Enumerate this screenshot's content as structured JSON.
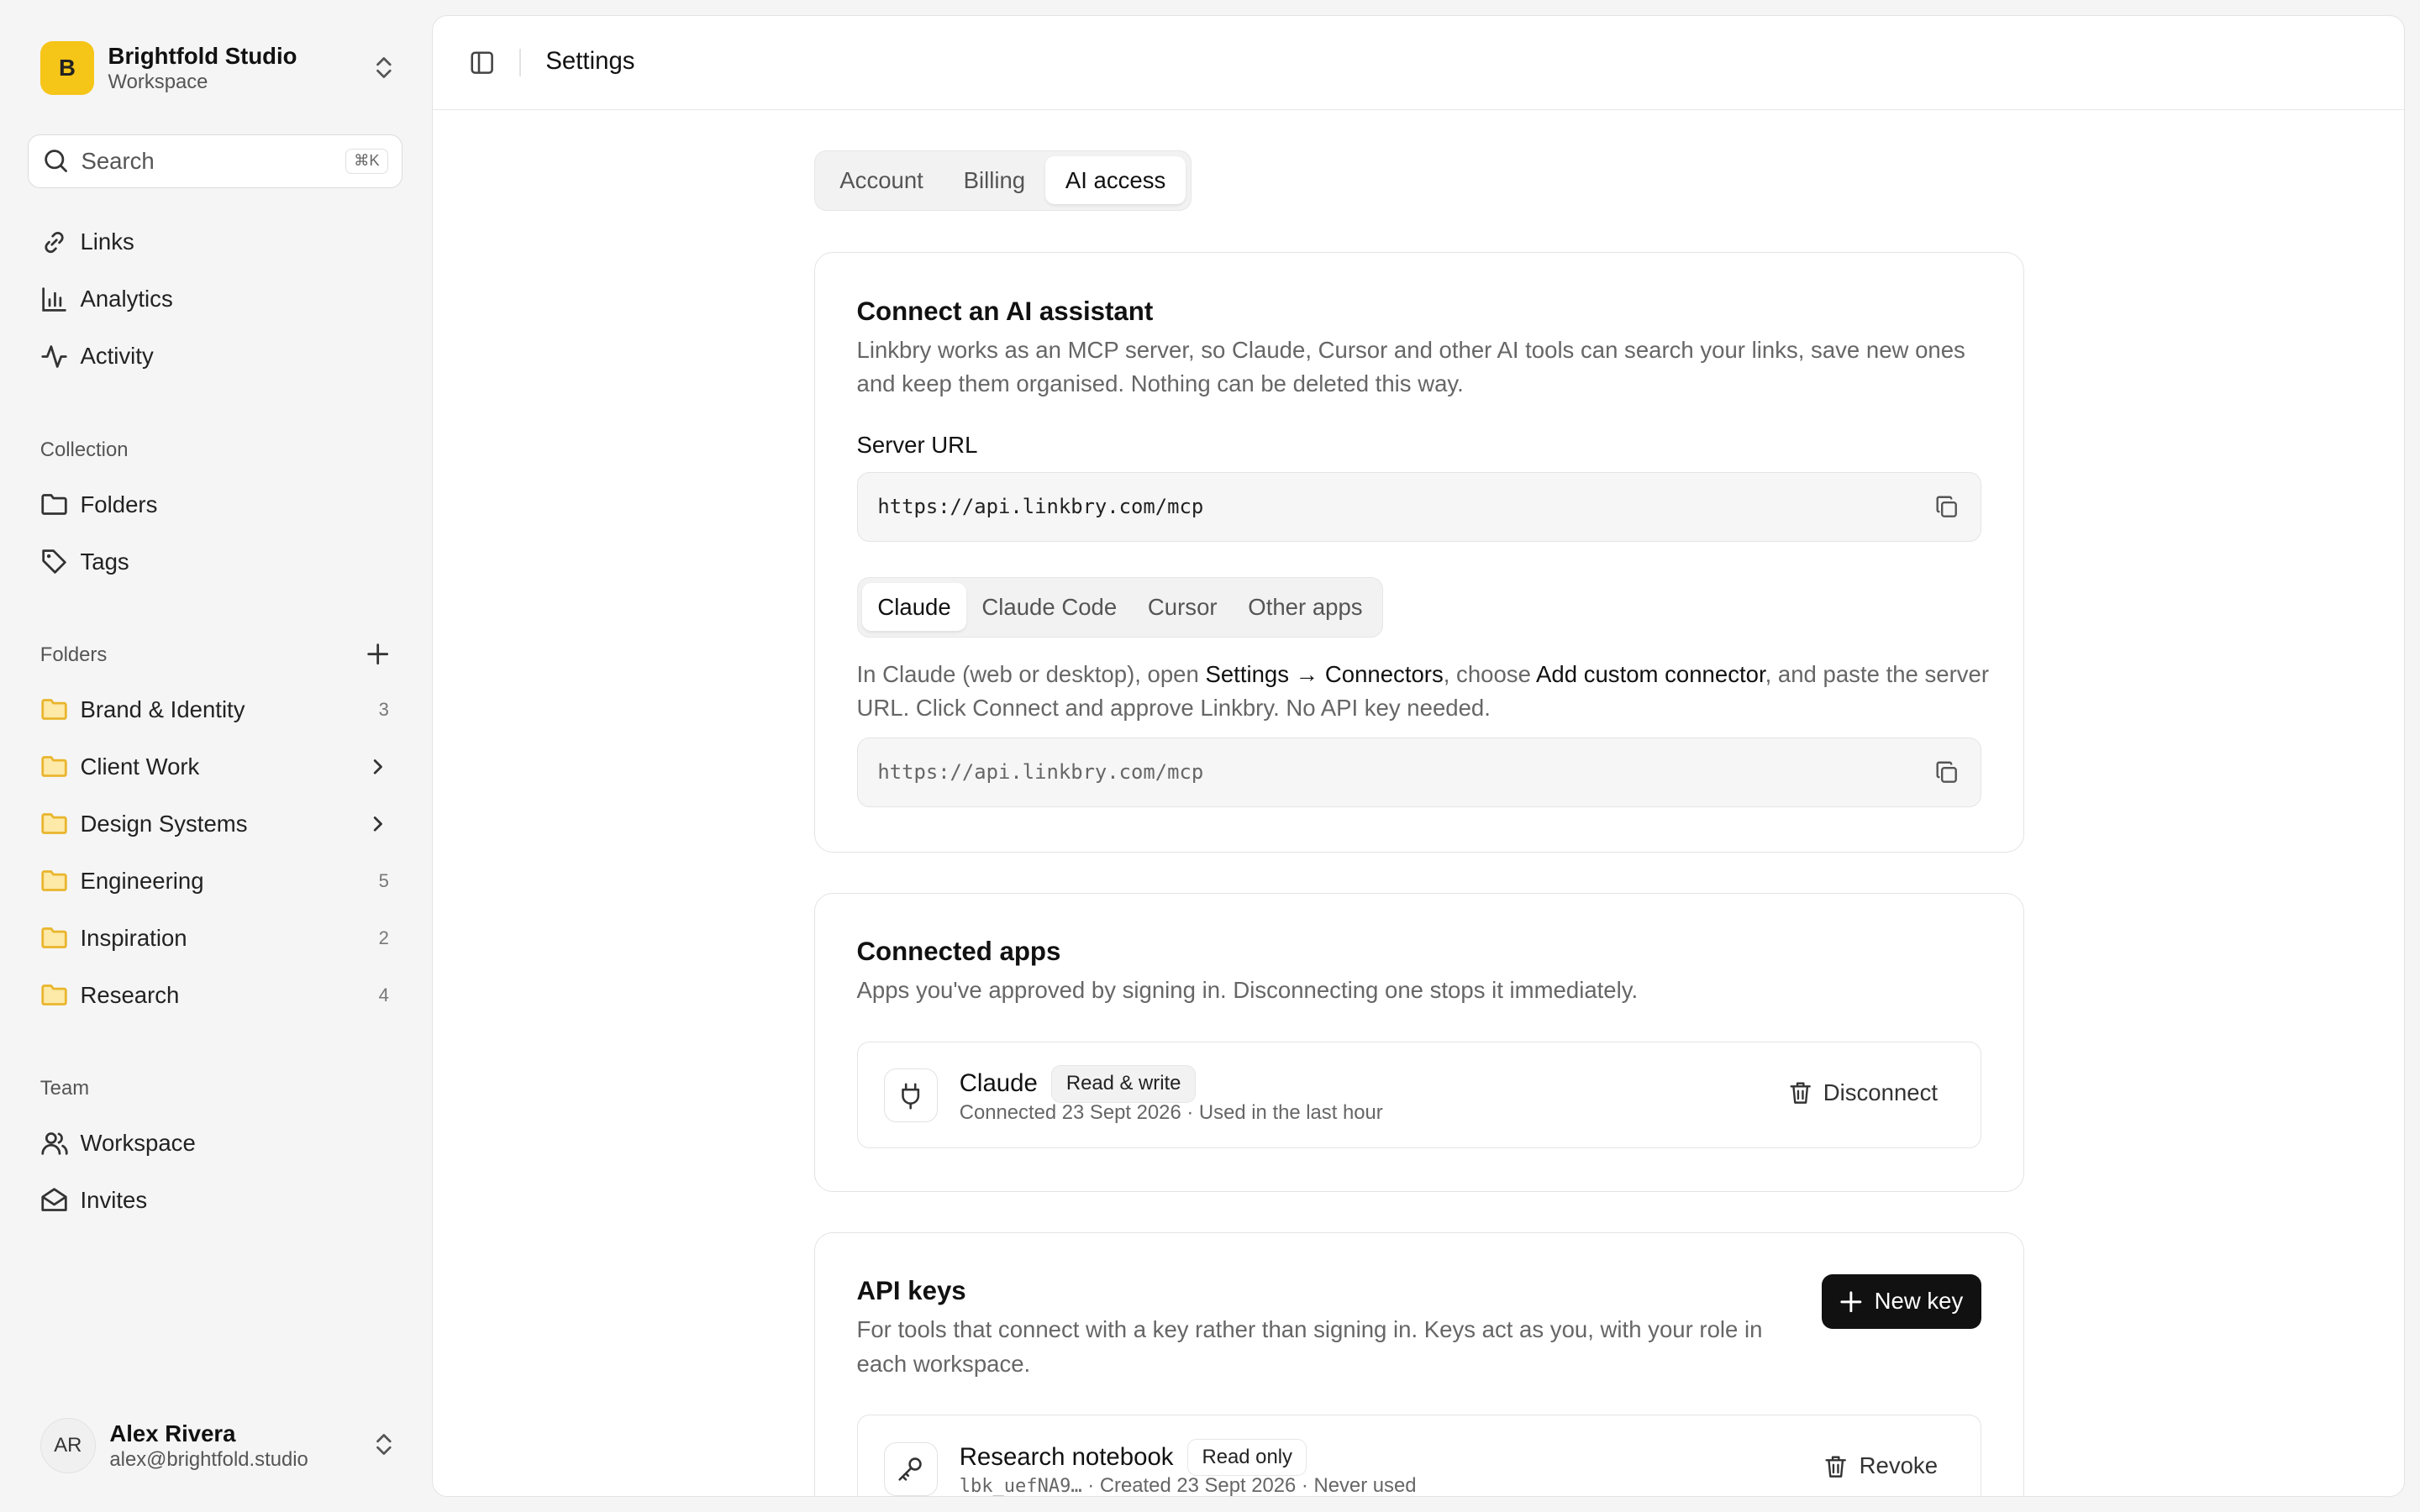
{
  "workspace": {
    "initial": "B",
    "name": "Brightfold Studio",
    "subtitle": "Workspace"
  },
  "search": {
    "placeholder": "Search",
    "shortcut": "⌘K"
  },
  "nav": [
    {
      "label": "Links",
      "icon": "link-icon"
    },
    {
      "label": "Analytics",
      "icon": "bar-chart-icon"
    },
    {
      "label": "Activity",
      "icon": "activity-icon"
    }
  ],
  "collection": {
    "label": "Collection",
    "items": [
      {
        "label": "Folders",
        "icon": "folder-icon"
      },
      {
        "label": "Tags",
        "icon": "tag-icon"
      }
    ]
  },
  "folders": {
    "label": "Folders",
    "items": [
      {
        "label": "Brand & Identity",
        "count": "3"
      },
      {
        "label": "Client Work",
        "expandable": true
      },
      {
        "label": "Design Systems",
        "expandable": true
      },
      {
        "label": "Engineering",
        "count": "5"
      },
      {
        "label": "Inspiration",
        "count": "2"
      },
      {
        "label": "Research",
        "count": "4"
      }
    ],
    "accent_color": "#e9b52c"
  },
  "team": {
    "label": "Team",
    "items": [
      {
        "label": "Workspace",
        "icon": "users-icon"
      },
      {
        "label": "Invites",
        "icon": "mail-open-icon"
      }
    ]
  },
  "user": {
    "initials": "AR",
    "name": "Alex Rivera",
    "email": "alex@brightfold.studio"
  },
  "header": {
    "title": "Settings"
  },
  "tabs": [
    {
      "label": "Account"
    },
    {
      "label": "Billing"
    },
    {
      "label": "AI access",
      "active": true
    }
  ],
  "connect": {
    "title": "Connect an AI assistant",
    "description": "Linkbry works as an MCP server, so Claude, Cursor and other AI tools can search your links, save new ones and keep them organised. Nothing can be deleted this way.",
    "server_label": "Server URL",
    "server_url": "https://api.linkbry.com/mcp",
    "client_tabs": [
      {
        "label": "Claude",
        "active": true
      },
      {
        "label": "Claude Code"
      },
      {
        "label": "Cursor"
      },
      {
        "label": "Other apps"
      }
    ],
    "instructions": {
      "part1": "In Claude (web or desktop), open ",
      "strong1": "Settings → Connectors",
      "part2": ", choose ",
      "strong2": "Add custom connector",
      "part3": ", and paste the server URL. Click Connect and approve Linkbry. No API key needed."
    },
    "instruction_url": "https://api.linkbry.com/mcp"
  },
  "connected_apps": {
    "title": "Connected apps",
    "description": "Apps you've approved by signing in. Disconnecting one stops it immediately.",
    "items": [
      {
        "name": "Claude",
        "badge": "Read & write",
        "meta": "Connected 23 Sept 2026 · Used in the last hour",
        "action": "Disconnect"
      }
    ]
  },
  "api_keys": {
    "title": "API keys",
    "description": "For tools that connect with a key rather than signing in. Keys act as you, with your role in each workspace.",
    "new_key_label": "New key",
    "items": [
      {
        "name": "Research notebook",
        "badge": "Read only",
        "key": "lbk_uefNA9…",
        "meta": " · Created 23 Sept 2026 · Never used",
        "action": "Revoke"
      }
    ]
  }
}
